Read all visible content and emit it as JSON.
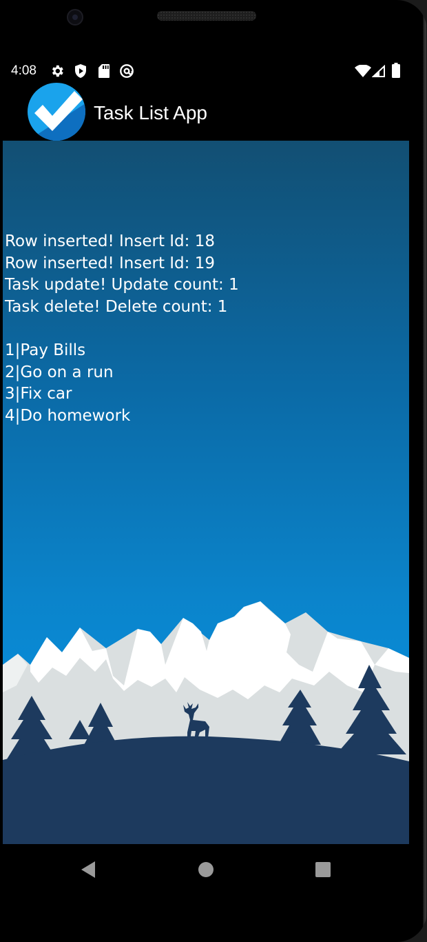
{
  "status_bar": {
    "time": "4:08",
    "left_icons": [
      "gear-icon",
      "shield-icon",
      "sd-card-icon",
      "at-sign-icon"
    ],
    "right_icons": [
      "wifi-icon",
      "signal-icon",
      "battery-icon"
    ]
  },
  "app_bar": {
    "title": "Task List App",
    "logo_icon": "checkmark-icon"
  },
  "messages": [
    "Row inserted! Insert Id: 18",
    "Row inserted! Insert Id: 19",
    "Task update! Update count: 1",
    "Task delete! Delete count: 1"
  ],
  "tasks": [
    "1|Pay Bills",
    "2|Go on a run",
    "3|Fix car",
    "4|Do homework"
  ],
  "navigation": {
    "icons": [
      "back-icon",
      "home-icon",
      "recents-icon"
    ]
  },
  "colors": {
    "background_top": "#124f73",
    "background_bottom": "#0398ec",
    "mountain_snow": "#ffffff",
    "mountain_shadow": "#dadfe0",
    "hill": "#1d3a5e",
    "text": "#ffffff"
  }
}
